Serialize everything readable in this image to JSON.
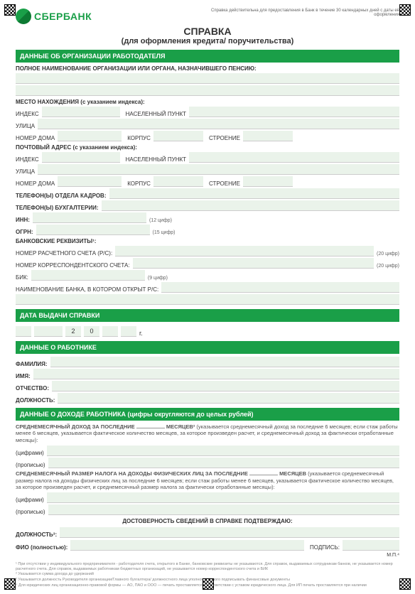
{
  "topnote": "Справка действительна для предоставления в Банк в течение 30 календарных дней с даты её оформления",
  "logo": "СБЕРБАНК",
  "title": "СПРАВКА",
  "subtitle": "(для оформления кредита/ поручительства)",
  "s1": {
    "head": "ДАННЫЕ ОБ ОРГАНИЗАЦИИ РАБОТОДАТЕЛЯ",
    "fullname": "ПОЛНОЕ НАИМЕНОВАНИЕ ОРГАНИЗАЦИИ ИЛИ ОРГАНА, НАЗНАЧИВШЕГО ПЕНСИЮ:",
    "loc_head": "МЕСТО НАХОЖДЕНИЯ (с указанием индекса):",
    "post_head": "ПОЧТОВЫЙ АДРЕС (с указанием индекса):",
    "index": "ИНДЕКС",
    "city": "НАСЕЛЕННЫЙ ПУНКТ",
    "street": "УЛИЦА",
    "house": "НОМЕР ДОМА",
    "korpus": "КОРПУС",
    "stroenie": "СТРОЕНИЕ",
    "tel_hr": "ТЕЛЕФОН(Ы) ОТДЕЛА КАДРОВ:",
    "tel_acc": "ТЕЛЕФОН(Ы) БУХГАЛТЕРИИ:",
    "inn": "ИНН:",
    "inn_hint": "(12 цифр)",
    "ogrn": "ОГРН:",
    "ogrn_hint": "(15 цифр)",
    "bank_head": "БАНКОВСКИЕ РЕКВИЗИТЫ¹:",
    "rs": "НОМЕР РАСЧЕТНОГО СЧЕТА (Р/С):",
    "rs_hint": "(20 цифр)",
    "ks": "НОМЕР КОРРЕСПОНДЕНТСКОГО СЧЕТА:",
    "ks_hint": "(20 цифр)",
    "bik": "БИК:",
    "bik_hint": "(9 цифр)",
    "bankname": "НАИМЕНОВАНИЕ БАНКА, В КОТОРОМ ОТКРЫТ Р/С:"
  },
  "s2": {
    "head": "ДАТА ВЫДАЧИ СПРАВКИ",
    "d2": "2",
    "d0": "0",
    "g": "г."
  },
  "s3": {
    "head": "ДАННЫЕ О РАБОТНИКЕ",
    "fam": "ФАМИЛИЯ:",
    "imya": "ИМЯ:",
    "otch": "ОТЧЕСТВО:",
    "dol": "ДОЛЖНОСТЬ:"
  },
  "s4": {
    "head": "ДАННЫЕ О ДОХОДЕ РАБОТНИКА (цифры округляются до целых рублей)",
    "income_l": "СРЕДНЕМЕСЯЧНЫЙ ДОХОД ЗА ПОСЛЕДНИЕ",
    "income_m": "МЕСЯЦЕВ²",
    "income_note": "(указывается среднемесячный доход за последние 6 месяцев; если стаж работы менее 6 месяцев, указывается фактическое количество месяцев, за которое произведен расчет, и среднемесячный доход за фактически отработанные месяцы):",
    "cifr": "(цифрами)",
    "prop": "(прописью)",
    "tax_l": "СРЕДНЕМЕСЯЧНЫЙ РАЗМЕР НАЛОГА НА ДОХОДЫ ФИЗИЧЕСКИХ ЛИЦ ЗА ПОСЛЕДНИЕ",
    "tax_m": "МЕСЯЦЕВ",
    "tax_note": "(указывается среднемесячный размер налога на доходы физических лиц за последние 6 месяцев; если стаж работы менее 6 месяцев, указывается фактическое количество месяцев, за которое произведен расчет, и среднемесячный размер налога за фактически отработанные месяцы):",
    "confirm": "ДОСТОВЕРНОСТЬ СВЕДЕНИЙ В СПРАВКЕ ПОДТВЕРЖДАЮ:",
    "dol": "ДОЛЖНОСТЬ³:",
    "fio": "ФИО (полностью):",
    "sign": "ПОДПИСЬ:",
    "mp": "М.П.⁴"
  },
  "fn": {
    "f1": "¹ При отсутствии у индивидуального предпринимателя - работодателя счета, открытого в Банке, банковские реквизиты не указываются. Для справок, выдаваемых сотрудникам банков, не указывается номер расчетного счета. Для справок, выдаваемых работникам бюджетных организаций, не указывается номер корреспондентского счета и БИК",
    "f2": "² Указывается сумма дохода до удержаний",
    "f3": "³ Указывается должность Руководителя организации/Главного бухгалтера/ должностного лица уполномоченного подписывать финансовые документы",
    "f4": "⁴ Для юридических лиц организационно-правовой формы — АО, ПАО и ООО — печать проставляется в соответствии с уставом юридического лица. Для ИП печать проставляется при наличии"
  }
}
